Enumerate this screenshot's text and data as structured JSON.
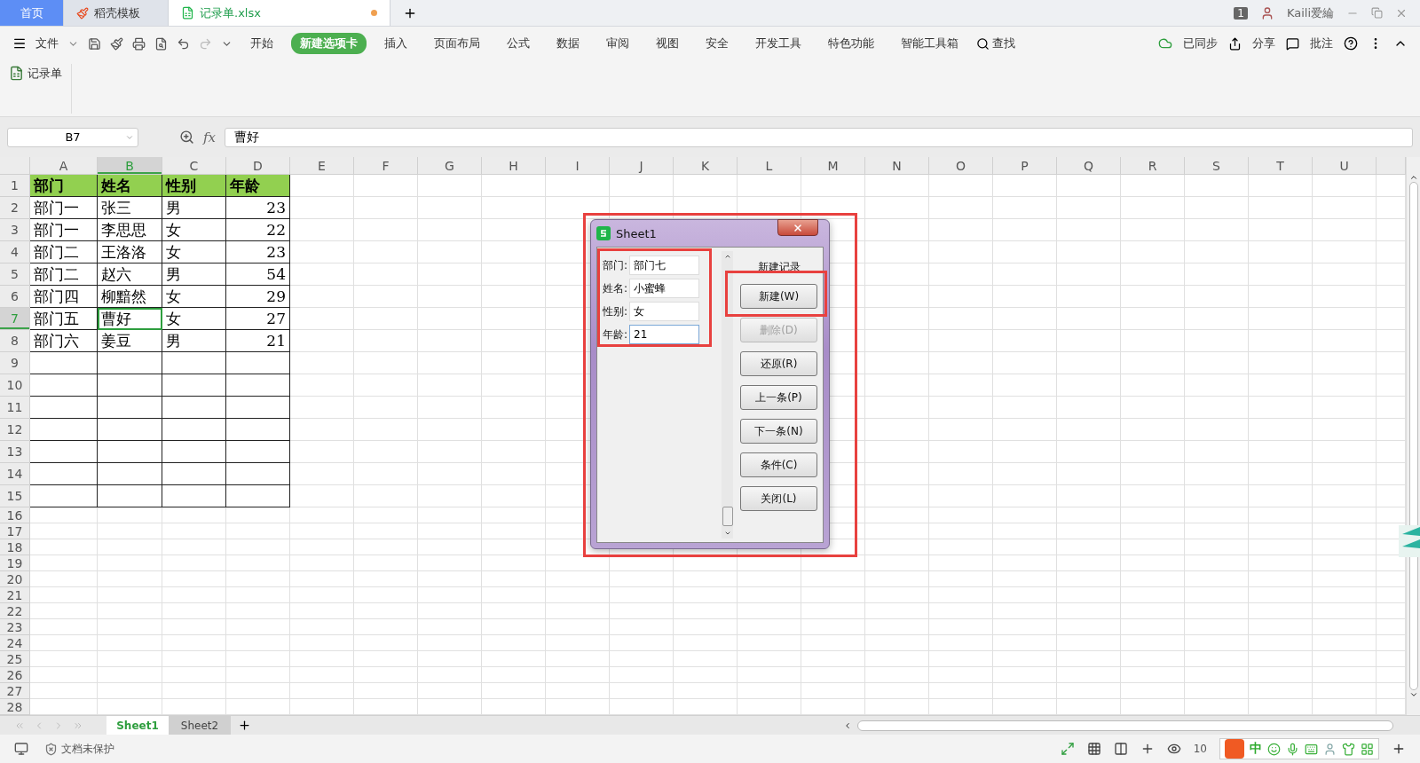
{
  "tabs": [
    {
      "label": "首页",
      "selected": false,
      "kind": "home"
    },
    {
      "label": "稻壳模板",
      "selected": false,
      "kind": "docer"
    },
    {
      "label": "记录单.xlsx",
      "selected": true,
      "kind": "sheet",
      "modified": true
    }
  ],
  "account": {
    "badge": "1",
    "user": "Kaili爱綸"
  },
  "menu": {
    "file": "文件",
    "items": [
      {
        "label": "开始",
        "selected": false
      },
      {
        "label": "新建选项卡",
        "selected": true
      },
      {
        "label": "插入",
        "selected": false
      },
      {
        "label": "页面布局",
        "selected": false
      },
      {
        "label": "公式",
        "selected": false
      },
      {
        "label": "数据",
        "selected": false
      },
      {
        "label": "审阅",
        "selected": false
      },
      {
        "label": "视图",
        "selected": false
      },
      {
        "label": "安全",
        "selected": false
      },
      {
        "label": "开发工具",
        "selected": false
      },
      {
        "label": "特色功能",
        "selected": false
      },
      {
        "label": "智能工具箱",
        "selected": false
      }
    ],
    "search": "查找",
    "sync": "已同步",
    "share": "分享",
    "comment": "批注"
  },
  "ribbon": {
    "button": "记录单"
  },
  "formula_bar": {
    "cell": "B7",
    "fx": "fx",
    "value": "曹好"
  },
  "sheet": {
    "columns": [
      {
        "label": "A",
        "selected": false
      },
      {
        "label": "B",
        "selected": true
      },
      {
        "label": "C",
        "selected": false
      },
      {
        "label": "D",
        "selected": false
      },
      {
        "label": "E",
        "selected": false
      },
      {
        "label": "F",
        "selected": false
      },
      {
        "label": "G",
        "selected": false
      },
      {
        "label": "H",
        "selected": false
      },
      {
        "label": "I",
        "selected": false
      },
      {
        "label": "J",
        "selected": false
      },
      {
        "label": "K",
        "selected": false
      },
      {
        "label": "L",
        "selected": false
      },
      {
        "label": "M",
        "selected": false
      },
      {
        "label": "N",
        "selected": false
      },
      {
        "label": "O",
        "selected": false
      },
      {
        "label": "P",
        "selected": false
      },
      {
        "label": "Q",
        "selected": false
      },
      {
        "label": "R",
        "selected": false
      },
      {
        "label": "S",
        "selected": false
      },
      {
        "label": "T",
        "selected": false
      },
      {
        "label": "U",
        "selected": false
      }
    ],
    "rows": [
      {
        "label": "1",
        "selected": false
      },
      {
        "label": "2",
        "selected": false
      },
      {
        "label": "3",
        "selected": false
      },
      {
        "label": "4",
        "selected": false
      },
      {
        "label": "5",
        "selected": false
      },
      {
        "label": "6",
        "selected": false
      },
      {
        "label": "7",
        "selected": true
      },
      {
        "label": "8",
        "selected": false
      },
      {
        "label": "9",
        "selected": false
      },
      {
        "label": "10",
        "selected": false
      },
      {
        "label": "11",
        "selected": false
      },
      {
        "label": "12",
        "selected": false
      },
      {
        "label": "13",
        "selected": false
      },
      {
        "label": "14",
        "selected": false
      },
      {
        "label": "15",
        "selected": false
      },
      {
        "label": "16",
        "selected": false
      },
      {
        "label": "17",
        "selected": false
      },
      {
        "label": "18",
        "selected": false
      },
      {
        "label": "19",
        "selected": false
      },
      {
        "label": "20",
        "selected": false
      },
      {
        "label": "21",
        "selected": false
      },
      {
        "label": "22",
        "selected": false
      },
      {
        "label": "23",
        "selected": false
      },
      {
        "label": "24",
        "selected": false
      },
      {
        "label": "25",
        "selected": false
      },
      {
        "label": "26",
        "selected": false
      },
      {
        "label": "27",
        "selected": false
      },
      {
        "label": "28",
        "selected": false
      }
    ]
  },
  "table": {
    "columns": [
      {
        "label": "部门",
        "kind": "text"
      },
      {
        "label": "姓名",
        "kind": "text"
      },
      {
        "label": "性别",
        "kind": "text"
      },
      {
        "label": "年龄",
        "kind": "number"
      }
    ],
    "rows": [
      {
        "cells": [
          {
            "text": "部门一",
            "selected": false
          },
          {
            "text": "张三",
            "selected": false
          },
          {
            "text": "男",
            "selected": false
          },
          {
            "text": "23",
            "selected": false
          }
        ]
      },
      {
        "cells": [
          {
            "text": "部门一",
            "selected": false
          },
          {
            "text": "李思思",
            "selected": false
          },
          {
            "text": "女",
            "selected": false
          },
          {
            "text": "22",
            "selected": false
          }
        ]
      },
      {
        "cells": [
          {
            "text": "部门二",
            "selected": false
          },
          {
            "text": "王洛洛",
            "selected": false
          },
          {
            "text": "女",
            "selected": false
          },
          {
            "text": "23",
            "selected": false
          }
        ]
      },
      {
        "cells": [
          {
            "text": "部门二",
            "selected": false
          },
          {
            "text": "赵六",
            "selected": false
          },
          {
            "text": "男",
            "selected": false
          },
          {
            "text": "54",
            "selected": false
          }
        ]
      },
      {
        "cells": [
          {
            "text": "部门四",
            "selected": false
          },
          {
            "text": "柳黯然",
            "selected": false
          },
          {
            "text": "女",
            "selected": false
          },
          {
            "text": "29",
            "selected": false
          }
        ]
      },
      {
        "cells": [
          {
            "text": "部门五",
            "selected": false
          },
          {
            "text": "曹好",
            "selected": true
          },
          {
            "text": "女",
            "selected": false
          },
          {
            "text": "27",
            "selected": false
          }
        ]
      },
      {
        "cells": [
          {
            "text": "部门六",
            "selected": false
          },
          {
            "text": "姜豆",
            "selected": false
          },
          {
            "text": "男",
            "selected": false
          },
          {
            "text": "21",
            "selected": false
          }
        ]
      }
    ]
  },
  "dialog": {
    "title": "Sheet1",
    "fields": [
      {
        "label": "部门:",
        "value": "部门七",
        "focused": false
      },
      {
        "label": "姓名:",
        "value": "小蜜蜂",
        "focused": false
      },
      {
        "label": "性别:",
        "value": "女",
        "focused": false
      },
      {
        "label": "年龄:",
        "value": "21",
        "focused": true
      }
    ],
    "status": "新建记录",
    "buttons": [
      {
        "label": "新建(W)",
        "disabled": false
      },
      {
        "label": "删除(D)",
        "disabled": true
      },
      {
        "label": "还原(R)",
        "disabled": false
      },
      {
        "label": "上一条(P)",
        "disabled": false
      },
      {
        "label": "下一条(N)",
        "disabled": false
      },
      {
        "label": "条件(C)",
        "disabled": false
      },
      {
        "label": "关闭(L)",
        "disabled": false
      }
    ]
  },
  "sheet_tabs": [
    {
      "label": "Sheet1",
      "selected": true
    },
    {
      "label": "Sheet2",
      "selected": false
    }
  ],
  "status_bar": {
    "protection": "文档未保护",
    "zoom": "10",
    "ime": "中"
  }
}
